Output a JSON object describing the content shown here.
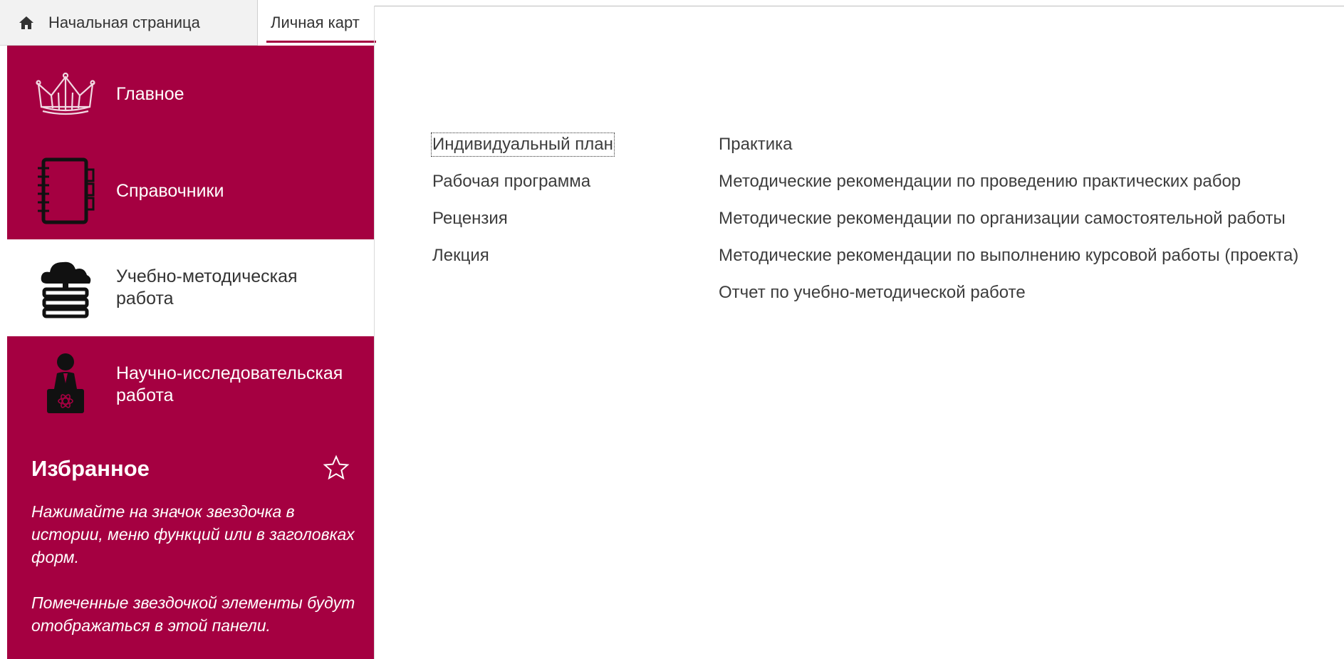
{
  "tabs": {
    "home": "Начальная страница",
    "card": "Личная карт"
  },
  "sidebar": {
    "items": [
      {
        "label": "Главное",
        "icon": "crown-icon"
      },
      {
        "label": "Справочники",
        "icon": "notebook-icon"
      },
      {
        "label": "Учебно-методическая работа",
        "icon": "books-cloud-icon"
      },
      {
        "label": "Научно-исследовательская работа",
        "icon": "researcher-laptop-icon"
      }
    ],
    "active_item": "Учебно-методическая работа",
    "favorites": {
      "title": "Избранное",
      "hint1": "Нажимайте на значок звездочка в истории, меню функций или в заголовках форм.",
      "hint2": "Помеченные звездочкой элементы будут отображаться в этой панели."
    }
  },
  "content": {
    "left_links": [
      "Индивидуальный план",
      "Рабочая программа",
      "Рецензия",
      "Лекция"
    ],
    "right_links": [
      "Практика",
      "Методические рекомендации по проведению практических рабор",
      "Методические рекомендации по организации самостоятельной работы",
      "Методические рекомендации по выполнению курсовой работы (проекта)",
      "Отчет по учебно-методической работе"
    ]
  },
  "colors": {
    "accent": "#a50041",
    "tabbar_bg": "#f2f2f2",
    "text": "#333333"
  }
}
